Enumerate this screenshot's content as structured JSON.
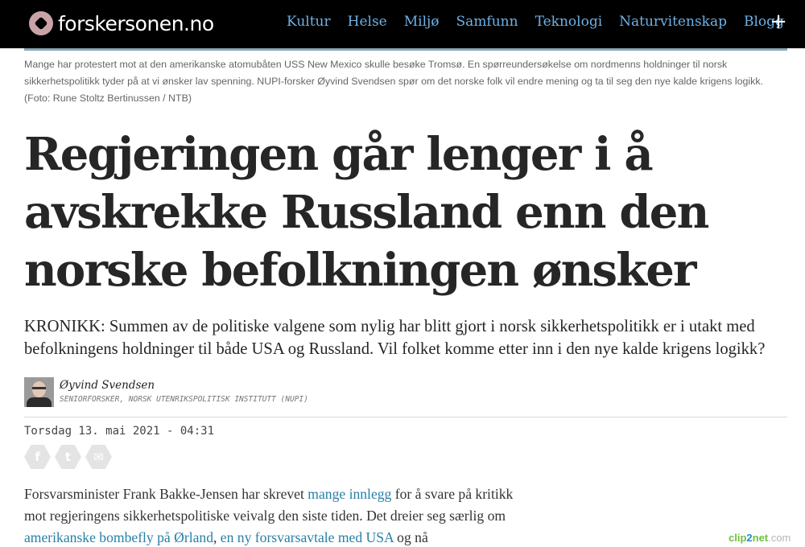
{
  "site": {
    "logo_text": "forskersonen.no",
    "nav": [
      "Kultur",
      "Helse",
      "Miljø",
      "Samfunn",
      "Teknologi",
      "Naturvitenskap",
      "Blogg"
    ],
    "menu_icon": "plus-icon",
    "menu_symbol": "+"
  },
  "photo": {
    "caption": "Mange har protestert mot at den amerikanske atomubåten USS New Mexico skulle besøke Tromsø. En spørreundersøkelse om nordmenns holdninger til norsk sikkerhetspolitikk tyder på at vi ønsker lav spenning. NUPI-forsker Øyvind Svendsen spør om det norske folk vil endre mening og ta til seg den nye kalde krigens logikk.",
    "credit": "(Foto: Rune Stoltz Bertinussen / NTB)"
  },
  "article": {
    "headline": "Regjeringen går lenger i å avskrekke Russland enn den norske befolkningen ønsker",
    "lead": "KRONIKK: Summen av de politiske valgene som nylig har blitt gjort i norsk sikkerhetspolitikk er i utakt med befolkningens holdninger til både USA og Russland. Vil folket komme etter inn i den nye kalde krigens logikk?",
    "author_name": "Øyvind Svendsen",
    "author_role": "SENIORFORSKER, NORSK UTENRIKSPOLITISK INSTITUTT (NUPI)",
    "date": "Torsdag 13. mai 2021 - 04:31",
    "share_icons": [
      "facebook-icon",
      "twitter-icon",
      "email-icon"
    ],
    "share_glyphs": [
      "f",
      "t",
      "✉"
    ],
    "body": {
      "t1": "Forsvarsminister Frank Bakke-Jensen har skrevet ",
      "link1": "mange innlegg",
      "t2": " for å svare på kritikk mot regjeringens sikkerhetspolitiske veivalg den siste tiden. Det dreier seg særlig om ",
      "link2": "amerikanske bombefly på Ørland",
      "t3": ", ",
      "link3": "en ny forsvarsavtale med USA",
      "t4": " og nå"
    }
  },
  "watermark": {
    "a": "clip",
    "b": "2",
    "c": "net",
    "d": ".com"
  }
}
